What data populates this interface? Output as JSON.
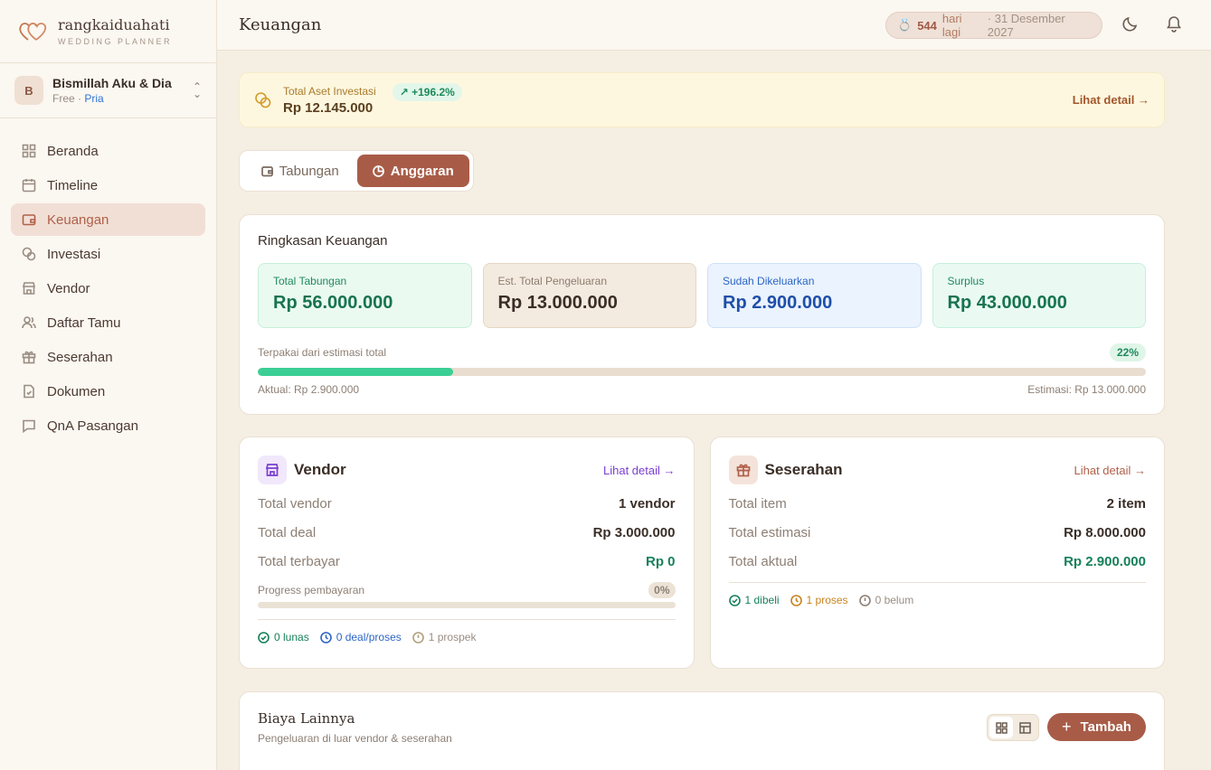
{
  "brand": {
    "name": "rangkaiduahati",
    "tagline": "WEDDING PLANNER"
  },
  "account": {
    "initial": "B",
    "name": "Bismillah Aku & Dia",
    "plan": "Free",
    "separator": "·",
    "role": "Pria"
  },
  "sidebar": {
    "items": [
      {
        "label": "Beranda",
        "icon": "grid-icon"
      },
      {
        "label": "Timeline",
        "icon": "calendar-icon"
      },
      {
        "label": "Keuangan",
        "icon": "wallet-icon",
        "active": true
      },
      {
        "label": "Investasi",
        "icon": "coins-icon"
      },
      {
        "label": "Vendor",
        "icon": "store-icon"
      },
      {
        "label": "Daftar Tamu",
        "icon": "users-icon"
      },
      {
        "label": "Seserahan",
        "icon": "gift-icon"
      },
      {
        "label": "Dokumen",
        "icon": "document-icon"
      },
      {
        "label": "QnA Pasangan",
        "icon": "chat-icon"
      }
    ]
  },
  "header": {
    "title": "Keuangan",
    "countdown": {
      "days": "544",
      "label": "hari lagi",
      "date": "· 31 Desember 2027"
    }
  },
  "banner": {
    "label": "Total Aset Investasi",
    "value": "Rp 12.145.000",
    "growth": "+196.2%",
    "link": "Lihat detail"
  },
  "tabs": [
    {
      "label": "Tabungan"
    },
    {
      "label": "Anggaran",
      "active": true
    }
  ],
  "summary": {
    "title": "Ringkasan Keuangan",
    "stats": [
      {
        "label": "Total Tabungan",
        "value": "Rp 56.000.000"
      },
      {
        "label": "Est. Total Pengeluaran",
        "value": "Rp 13.000.000"
      },
      {
        "label": "Sudah Dikeluarkan",
        "value": "Rp 2.900.000"
      },
      {
        "label": "Surplus",
        "value": "Rp 43.000.000"
      }
    ],
    "progress_label": "Terpakai dari estimasi total",
    "progress_pct": "22%",
    "progress_value": 0.22,
    "actual": "Aktual: Rp 2.900.000",
    "estimate": "Estimasi: Rp 13.000.000"
  },
  "vendor": {
    "title": "Vendor",
    "link": "Lihat detail",
    "rows": [
      {
        "k": "Total vendor",
        "v": "1 vendor"
      },
      {
        "k": "Total deal",
        "v": "Rp 3.000.000"
      },
      {
        "k": "Total terbayar",
        "v": "Rp 0"
      }
    ],
    "progress_label": "Progress pembayaran",
    "progress_pct": "0%",
    "progress_value": 0,
    "chips": {
      "lunas": "0 lunas",
      "deal": "0 deal/proses",
      "prospek": "1 prospek"
    }
  },
  "seserahan": {
    "title": "Seserahan",
    "link": "Lihat detail",
    "rows": [
      {
        "k": "Total item",
        "v": "2 item"
      },
      {
        "k": "Total estimasi",
        "v": "Rp 8.000.000"
      },
      {
        "k": "Total aktual",
        "v": "Rp 2.900.000"
      }
    ],
    "chips": {
      "dibeli": "1 dibeli",
      "proses": "1 proses",
      "belum": "0 belum"
    }
  },
  "other": {
    "title": "Biaya Lainnya",
    "subtitle": "Pengeluaran di luar vendor & seserahan",
    "add_label": "Tambah"
  },
  "colors": {
    "accent": "#a85c47",
    "green": "#17805a",
    "blue": "#2c65c5",
    "purple": "#7b3fd1"
  }
}
